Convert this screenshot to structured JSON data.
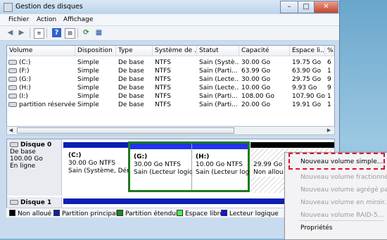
{
  "window": {
    "title": "Gestion des disques"
  },
  "menu": [
    "Fichier",
    "Action",
    "Affichage"
  ],
  "table": {
    "columns": [
      "Volume",
      "Disposition",
      "Type",
      "Système de ...",
      "Statut",
      "Capacité",
      "Espace li...",
      "%"
    ],
    "rows": [
      [
        "(C:)",
        "Simple",
        "De base",
        "NTFS",
        "Sain (Systè...",
        "30.00 Go",
        "19.75 Go",
        "6"
      ],
      [
        "(F:)",
        "Simple",
        "De base",
        "NTFS",
        "Sain (Parti...",
        "63.99 Go",
        "63.90 Go",
        "1"
      ],
      [
        "(G:)",
        "Simple",
        "De base",
        "NTFS",
        "Sain (Lecte...",
        "30.00 Go",
        "29.75 Go",
        "9"
      ],
      [
        "(H:)",
        "Simple",
        "De base",
        "NTFS",
        "Sain (Lecte...",
        "10.00 Go",
        "9.93 Go",
        "9"
      ],
      [
        "(I:)",
        "Simple",
        "De base",
        "NTFS",
        "Sain (Parti...",
        "108.00 Go",
        "107.90 Go",
        "1"
      ],
      [
        "partition réservée ...",
        "Simple",
        "De base",
        "NTFS",
        "Sain (Parti...",
        "20.00 Go",
        "19.91 Go",
        "1"
      ]
    ]
  },
  "disk0": {
    "label": "Disque 0",
    "type": "De base",
    "size": "100.00 Go",
    "status": "En ligne",
    "partitions": [
      {
        "name": "(C:)",
        "size": "30.00 Go NTFS",
        "status": "Sain (Système, Démar"
      },
      {
        "name": "(G:)",
        "size": "30.00 Go NTFS",
        "status": "Sain (Lecteur logique"
      },
      {
        "name": "(H:)",
        "size": "10.00 Go NTFS",
        "status": "Sain (Lecteur log"
      },
      {
        "name": "",
        "size": "29.99 Go",
        "status": "Non allou"
      }
    ]
  },
  "disk1": {
    "label": "Disque 1"
  },
  "legend": [
    {
      "label": "Non alloué",
      "color": "#000000"
    },
    {
      "label": "Partition principale",
      "color": "#1122a8"
    },
    {
      "label": "Partition étendue",
      "color": "#1e8a1e"
    },
    {
      "label": "Espace libre",
      "color": "#4cf44c"
    },
    {
      "label": "Lecteur logique",
      "color": "#1111ee"
    }
  ],
  "context_menu": {
    "items": [
      {
        "label": "Nouveau volume simple...",
        "enabled": true
      },
      {
        "label": "Nouveau volume fractionné...",
        "enabled": false
      },
      {
        "label": "Nouveau volume agrégé par ba",
        "enabled": false
      },
      {
        "label": "Nouveau volume en miroir...",
        "enabled": false
      },
      {
        "label": "Nouveau volume RAID-5...",
        "enabled": false
      },
      {
        "label": "Propriétés",
        "enabled": true
      }
    ]
  },
  "icons": [
    "window-icon",
    "back-icon",
    "forward-icon",
    "list-view-icon",
    "help-icon",
    "properties-icon",
    "refresh-icon",
    "disk-settings-icon"
  ]
}
